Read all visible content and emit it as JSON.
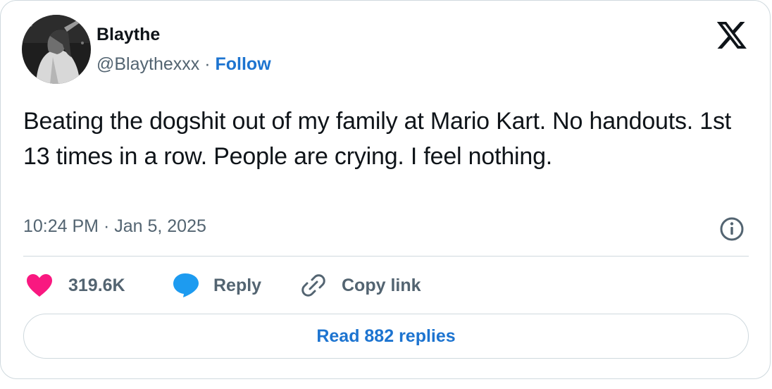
{
  "author": {
    "name": "Blaythe",
    "handle": "@Blaythexxx",
    "separator": "·",
    "follow_label": "Follow"
  },
  "tweet": {
    "text": "Beating the dogshit out of my family at Mario Kart. No handouts. 1st 13 times in a row. People are crying. I feel nothing.",
    "timestamp": "10:24 PM · Jan 5, 2025"
  },
  "actions": {
    "like_count": "319.6K",
    "reply_label": "Reply",
    "copy_link_label": "Copy link"
  },
  "read_replies_label": "Read 882 replies",
  "icons": {
    "brand": "x-logo-icon",
    "info": "info-icon",
    "like": "heart-icon",
    "reply": "speech-bubble-icon",
    "copy": "link-icon"
  },
  "colors": {
    "text_primary": "#0f1419",
    "text_secondary": "#536471",
    "link_blue": "#1d74d0",
    "heart_pink": "#f91880",
    "reply_blue": "#1d9bf0",
    "border": "#cfd9de"
  }
}
